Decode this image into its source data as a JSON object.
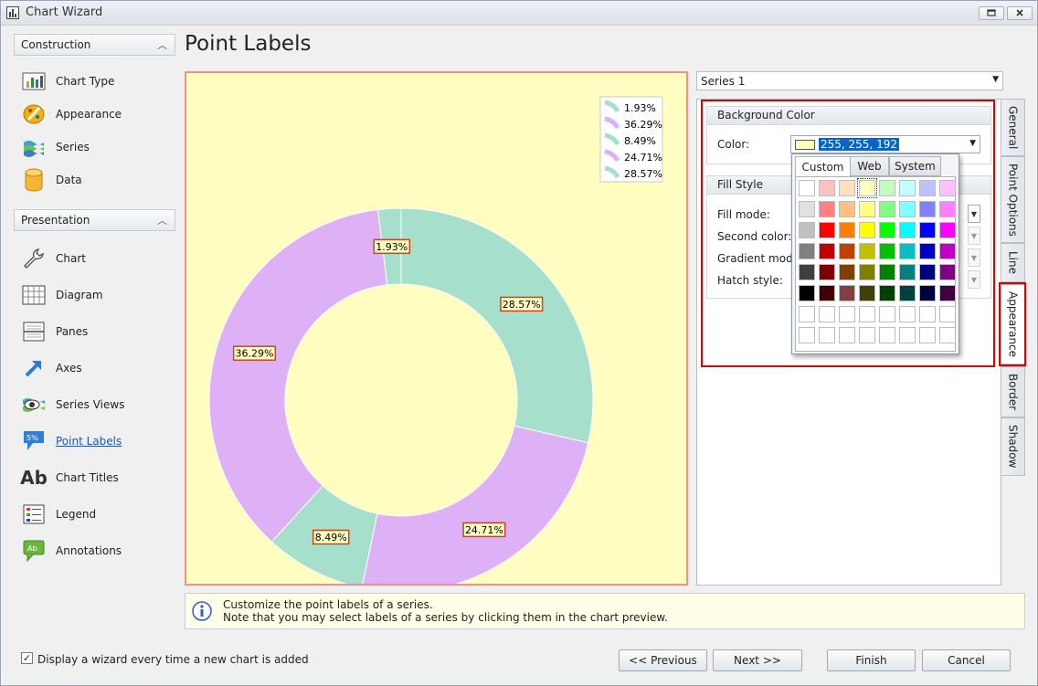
{
  "window": {
    "title": "Chart Wizard"
  },
  "nav": {
    "construction": {
      "header": "Construction",
      "items": [
        {
          "label": "Chart Type"
        },
        {
          "label": "Appearance"
        },
        {
          "label": "Series"
        },
        {
          "label": "Data"
        }
      ]
    },
    "presentation": {
      "header": "Presentation",
      "items": [
        {
          "label": "Chart"
        },
        {
          "label": "Diagram"
        },
        {
          "label": "Panes"
        },
        {
          "label": "Axes"
        },
        {
          "label": "Series Views"
        },
        {
          "label": "Point Labels",
          "active": true
        },
        {
          "label": "Chart Titles"
        },
        {
          "label": "Legend"
        },
        {
          "label": "Annotations"
        }
      ]
    }
  },
  "page": {
    "title": "Point Labels"
  },
  "chart_data": {
    "type": "pie",
    "style": "doughnut",
    "background": "#fffec0",
    "slices": [
      {
        "label": "1.93%",
        "value": 1.93,
        "color": "#a6dfcc"
      },
      {
        "label": "28.57%",
        "value": 28.57,
        "color": "#a6dfcc"
      },
      {
        "label": "24.71%",
        "value": 24.71,
        "color": "#deb0f5"
      },
      {
        "label": "8.49%",
        "value": 8.49,
        "color": "#a6dfcc"
      },
      {
        "label": "36.29%",
        "value": 36.29,
        "color": "#deb0f5"
      }
    ],
    "legend": {
      "placement": "top-right",
      "entries": [
        {
          "label": "1.93%",
          "color": "#a6dfcc"
        },
        {
          "label": "36.29%",
          "color": "#deb0f5"
        },
        {
          "label": "8.49%",
          "color": "#a6dfcc"
        },
        {
          "label": "24.71%",
          "color": "#deb0f5"
        },
        {
          "label": "28.57%",
          "color": "#a6dfcc"
        }
      ]
    }
  },
  "properties": {
    "series_select": "Series 1",
    "background_section": "Background Color",
    "color_label": "Color:",
    "color_value": "255, 255, 192",
    "color_swatch": "#ffffc0",
    "fill_section": "Fill Style",
    "fill_mode_label": "Fill mode:",
    "second_color_label": "Second color:",
    "gradient_mode_label": "Gradient mode",
    "hatch_style_label": "Hatch style:"
  },
  "color_popup": {
    "tabs": [
      "Custom",
      "Web",
      "System"
    ],
    "active_tab": "Custom",
    "palette": [
      [
        "#ffffff",
        "#ffc0c0",
        "#ffe0c0",
        "#ffffc0",
        "#c0ffc0",
        "#c0ffff",
        "#c0c0ff",
        "#ffc0ff"
      ],
      [
        "#e0e0e0",
        "#ff8080",
        "#ffc080",
        "#ffff80",
        "#80ff80",
        "#80ffff",
        "#8080ff",
        "#ff80ff"
      ],
      [
        "#c0c0c0",
        "#ff0000",
        "#ff8000",
        "#ffff00",
        "#00ff00",
        "#00ffff",
        "#0000ff",
        "#ff00ff"
      ],
      [
        "#808080",
        "#c00000",
        "#c04000",
        "#c0c000",
        "#00c000",
        "#00c0c0",
        "#0000c0",
        "#c000c0"
      ],
      [
        "#404040",
        "#800000",
        "#804000",
        "#808000",
        "#008000",
        "#008080",
        "#000080",
        "#800080"
      ],
      [
        "#000000",
        "#400000",
        "#804040",
        "#404000",
        "#004000",
        "#004040",
        "#000040",
        "#400040"
      ],
      [
        "#ffffff",
        "#ffffff",
        "#ffffff",
        "#ffffff",
        "#ffffff",
        "#ffffff",
        "#ffffff",
        "#ffffff"
      ],
      [
        "#ffffff",
        "#ffffff",
        "#ffffff",
        "#ffffff",
        "#ffffff",
        "#ffffff",
        "#ffffff",
        "#ffffff"
      ]
    ],
    "selected": [
      0,
      3
    ]
  },
  "side_tabs": [
    {
      "label": "General"
    },
    {
      "label": "Point Options"
    },
    {
      "label": "Line"
    },
    {
      "label": "Appearance",
      "active": true
    },
    {
      "label": "Border"
    },
    {
      "label": "Shadow"
    }
  ],
  "info": {
    "line1": "Customize the point labels of a series.",
    "line2": "Note that you may select labels of a series by clicking them in the chart preview."
  },
  "footer": {
    "checkbox_checked": true,
    "checkbox_mark": "✓",
    "checkbox_label": "Display a wizard every time a new chart is added",
    "previous": "<< Previous",
    "next": "Next >>",
    "finish": "Finish",
    "cancel": "Cancel"
  }
}
